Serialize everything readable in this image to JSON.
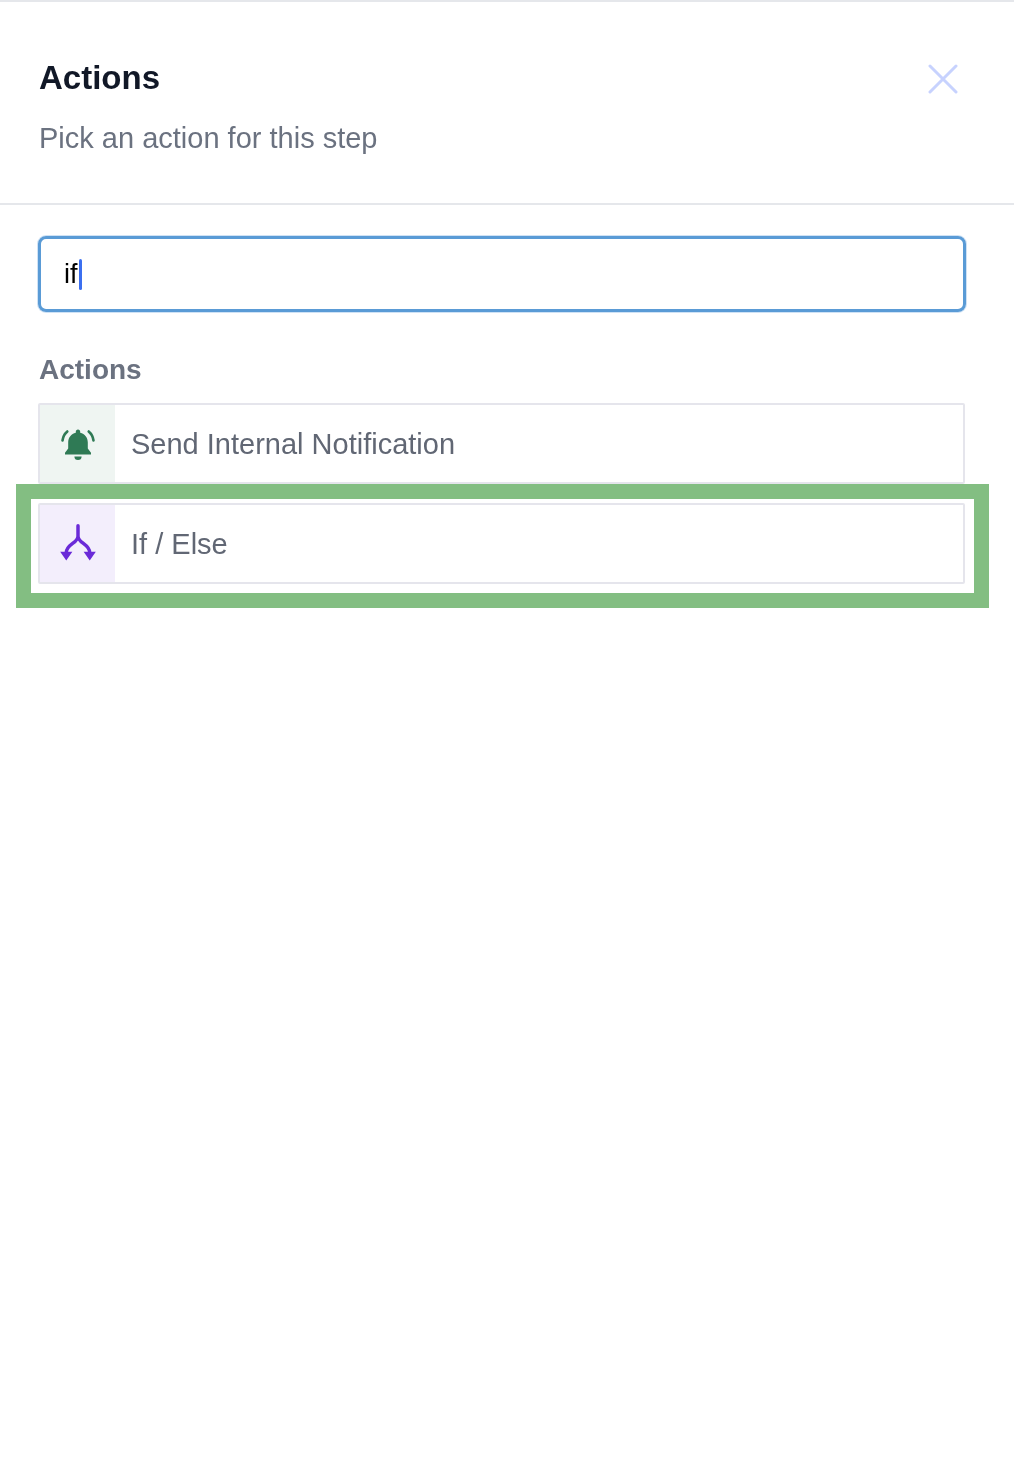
{
  "panel": {
    "title": "Actions",
    "subtitle": "Pick an action for this step"
  },
  "search": {
    "value": "if",
    "focused": true
  },
  "actions": {
    "heading": "Actions",
    "items": [
      {
        "label": "Send Internal Notification",
        "kind": "notify",
        "color": "#2f7a55",
        "highlighted": false
      },
      {
        "label": "If / Else",
        "kind": "condition",
        "color": "#6a2ad8",
        "highlighted": true
      }
    ]
  }
}
